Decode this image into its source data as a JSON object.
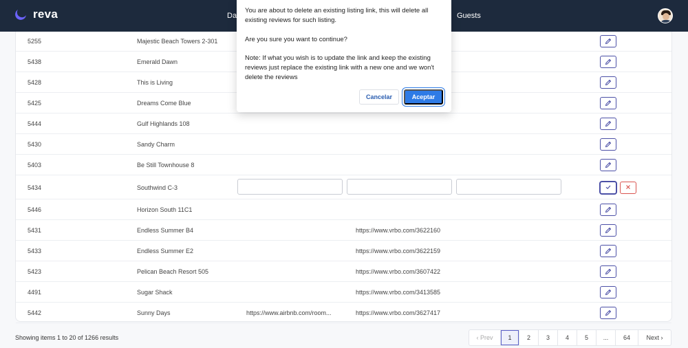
{
  "brand": {
    "name": "reva"
  },
  "nav": {
    "item_partial": "Das",
    "guests": "Guests"
  },
  "rows": [
    {
      "id": "5255",
      "name": "Majestic Beach Towers 2-301",
      "airbnb": "",
      "vrbo": ""
    },
    {
      "id": "5438",
      "name": "Emerald Dawn",
      "airbnb": "",
      "vrbo": ""
    },
    {
      "id": "5428",
      "name": "This is Living",
      "airbnb": "",
      "vrbo": ""
    },
    {
      "id": "5425",
      "name": "Dreams Come Blue",
      "airbnb": "",
      "vrbo": ""
    },
    {
      "id": "5444",
      "name": "Gulf Highlands 108",
      "airbnb": "",
      "vrbo": ""
    },
    {
      "id": "5430",
      "name": "Sandy Charm",
      "airbnb": "",
      "vrbo": ""
    },
    {
      "id": "5403",
      "name": "Be Still Townhouse 8",
      "airbnb": "",
      "vrbo": ""
    },
    {
      "id": "5434",
      "name": "Southwind C-3",
      "airbnb": "",
      "vrbo": "",
      "editing": true
    },
    {
      "id": "5446",
      "name": "Horizon South 11C1",
      "airbnb": "",
      "vrbo": ""
    },
    {
      "id": "5431",
      "name": "Endless Summer B4",
      "airbnb": "",
      "vrbo": "https://www.vrbo.com/3622160"
    },
    {
      "id": "5433",
      "name": "Endless Summer E2",
      "airbnb": "",
      "vrbo": "https://www.vrbo.com/3622159"
    },
    {
      "id": "5423",
      "name": "Pelican Beach Resort 505",
      "airbnb": "",
      "vrbo": "https://www.vrbo.com/3607422"
    },
    {
      "id": "4491",
      "name": "Sugar Shack",
      "airbnb": "",
      "vrbo": "https://www.vrbo.com/3413585"
    },
    {
      "id": "5442",
      "name": "Sunny Days",
      "airbnb": "https://www.airbnb.com/room...",
      "vrbo": "https://www.vrbo.com/3627417"
    }
  ],
  "footer": {
    "showing": "Showing items 1 to 20 of 1266 results"
  },
  "pagination": [
    "‹ Prev",
    "1",
    "2",
    "3",
    "4",
    "5",
    "...",
    "64",
    "Next ›"
  ],
  "modal": {
    "text1": "You are about to delete an existing listing link, this will delete all existing reviews for such listing.",
    "text2": "Are you sure you want to continue?",
    "text3": "Note: If what you wish is to update the link and keep the existing reviews just replace the existing link with a new one and we won't delete the reviews",
    "cancel": "Cancelar",
    "accept": "Aceptar"
  },
  "colors": {
    "topbar": "#1d2a3d",
    "accent": "#4b4fa6",
    "primary_button": "#2e7be6",
    "danger": "#d9534f"
  }
}
